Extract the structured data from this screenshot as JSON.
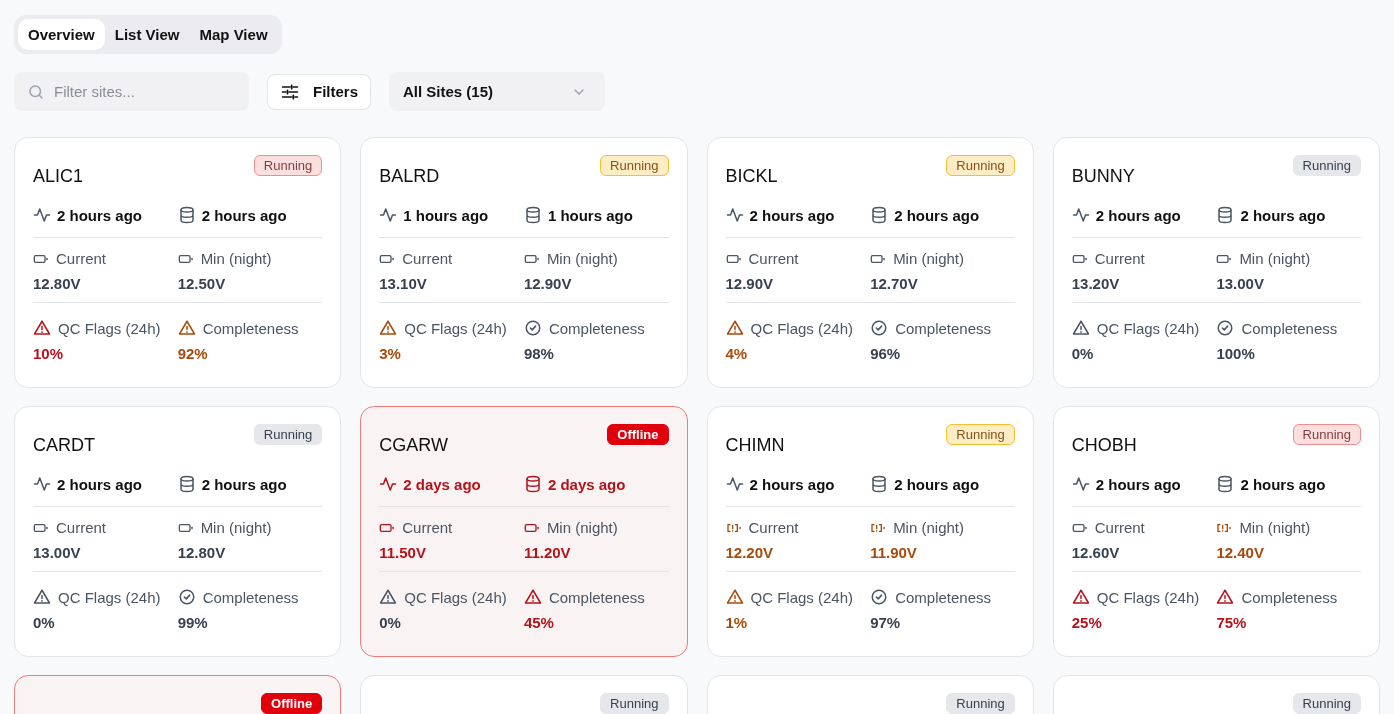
{
  "tabs": [
    {
      "label": "Overview",
      "selected": true
    },
    {
      "label": "List View",
      "selected": false
    },
    {
      "label": "Map View",
      "selected": false
    }
  ],
  "toolbar": {
    "search": {
      "placeholder": "Filter sites..."
    },
    "filters_button": "Filters",
    "site_select": "All Sites (15)"
  },
  "sites": [
    {
      "name": "ALIC1",
      "offline": false,
      "badge": {
        "label": "Running",
        "kind": "soft",
        "color": "#f28b8b"
      },
      "heartbeat": {
        "text": "2 hours ago",
        "critical": false
      },
      "data": {
        "text": "2 hours ago",
        "critical": false
      },
      "metrics": [
        {
          "kind": "battery",
          "label": "Current",
          "value": "12.80V",
          "warning": false,
          "critical": false
        },
        {
          "kind": "battery",
          "label": "Min (night)",
          "value": "12.50V",
          "warning": false,
          "critical": false
        },
        {
          "kind": "flags",
          "label": "QC Flags (24h)",
          "value": "10%",
          "warning": false,
          "critical": true
        },
        {
          "kind": "completeness",
          "label": "Completeness",
          "value": "92%",
          "warning": true,
          "critical": false
        }
      ]
    },
    {
      "name": "BALRD",
      "offline": false,
      "badge": {
        "label": "Running",
        "kind": "soft",
        "color": "#f5c030"
      },
      "heartbeat": {
        "text": "1 hours ago",
        "critical": false
      },
      "data": {
        "text": "1 hours ago",
        "critical": false
      },
      "metrics": [
        {
          "kind": "battery",
          "label": "Current",
          "value": "13.10V",
          "warning": false,
          "critical": false
        },
        {
          "kind": "battery",
          "label": "Min (night)",
          "value": "12.90V",
          "warning": false,
          "critical": false
        },
        {
          "kind": "flags",
          "label": "QC Flags (24h)",
          "value": "3%",
          "warning": true,
          "critical": false
        },
        {
          "kind": "completeness",
          "label": "Completeness",
          "value": "98%",
          "warning": false,
          "critical": false
        }
      ]
    },
    {
      "name": "BICKL",
      "offline": false,
      "badge": {
        "label": "Running",
        "kind": "soft",
        "color": "#f5c030"
      },
      "heartbeat": {
        "text": "2 hours ago",
        "critical": false
      },
      "data": {
        "text": "2 hours ago",
        "critical": false
      },
      "metrics": [
        {
          "kind": "battery",
          "label": "Current",
          "value": "12.90V",
          "warning": false,
          "critical": false
        },
        {
          "kind": "battery",
          "label": "Min (night)",
          "value": "12.70V",
          "warning": false,
          "critical": false
        },
        {
          "kind": "flags",
          "label": "QC Flags (24h)",
          "value": "4%",
          "warning": true,
          "critical": false
        },
        {
          "kind": "completeness",
          "label": "Completeness",
          "value": "96%",
          "warning": false,
          "critical": false
        }
      ]
    },
    {
      "name": "BUNNY",
      "offline": false,
      "badge": {
        "label": "Running",
        "kind": "plain",
        "color": "#e5e7eb"
      },
      "heartbeat": {
        "text": "2 hours ago",
        "critical": false
      },
      "data": {
        "text": "2 hours ago",
        "critical": false
      },
      "metrics": [
        {
          "kind": "battery",
          "label": "Current",
          "value": "13.20V",
          "warning": false,
          "critical": false
        },
        {
          "kind": "battery",
          "label": "Min (night)",
          "value": "13.00V",
          "warning": false,
          "critical": false
        },
        {
          "kind": "flags",
          "label": "QC Flags (24h)",
          "value": "0%",
          "warning": false,
          "critical": false
        },
        {
          "kind": "completeness",
          "label": "Completeness",
          "value": "100%",
          "warning": false,
          "critical": false
        }
      ]
    },
    {
      "name": "CARDT",
      "offline": false,
      "badge": {
        "label": "Running",
        "kind": "plain",
        "color": "#e5e7eb"
      },
      "heartbeat": {
        "text": "2 hours ago",
        "critical": false
      },
      "data": {
        "text": "2 hours ago",
        "critical": false
      },
      "metrics": [
        {
          "kind": "battery",
          "label": "Current",
          "value": "13.00V",
          "warning": false,
          "critical": false
        },
        {
          "kind": "battery",
          "label": "Min (night)",
          "value": "12.80V",
          "warning": false,
          "critical": false
        },
        {
          "kind": "flags",
          "label": "QC Flags (24h)",
          "value": "0%",
          "warning": false,
          "critical": false
        },
        {
          "kind": "completeness",
          "label": "Completeness",
          "value": "99%",
          "warning": false,
          "critical": false
        }
      ]
    },
    {
      "name": "CGARW",
      "offline": true,
      "badge": {
        "label": "Offline",
        "kind": "solid",
        "color": "#e0000b"
      },
      "heartbeat": {
        "text": "2 days ago",
        "critical": true
      },
      "data": {
        "text": "2 days ago",
        "critical": true
      },
      "metrics": [
        {
          "kind": "battery",
          "label": "Current",
          "value": "11.50V",
          "warning": false,
          "critical": true
        },
        {
          "kind": "battery",
          "label": "Min (night)",
          "value": "11.20V",
          "warning": false,
          "critical": true
        },
        {
          "kind": "flags",
          "label": "QC Flags (24h)",
          "value": "0%",
          "warning": false,
          "critical": false
        },
        {
          "kind": "completeness",
          "label": "Completeness",
          "value": "45%",
          "warning": false,
          "critical": true
        }
      ]
    },
    {
      "name": "CHIMN",
      "offline": false,
      "badge": {
        "label": "Running",
        "kind": "soft",
        "color": "#f5c030"
      },
      "heartbeat": {
        "text": "2 hours ago",
        "critical": false
      },
      "data": {
        "text": "2 hours ago",
        "critical": false
      },
      "metrics": [
        {
          "kind": "battery",
          "label": "Current",
          "value": "12.20V",
          "warning": true,
          "critical": false
        },
        {
          "kind": "battery",
          "label": "Min (night)",
          "value": "11.90V",
          "warning": true,
          "critical": false
        },
        {
          "kind": "flags",
          "label": "QC Flags (24h)",
          "value": "1%",
          "warning": true,
          "critical": false
        },
        {
          "kind": "completeness",
          "label": "Completeness",
          "value": "97%",
          "warning": false,
          "critical": false
        }
      ]
    },
    {
      "name": "CHOBH",
      "offline": false,
      "badge": {
        "label": "Running",
        "kind": "soft",
        "color": "#f28b8b"
      },
      "heartbeat": {
        "text": "2 hours ago",
        "critical": false
      },
      "data": {
        "text": "2 hours ago",
        "critical": false
      },
      "metrics": [
        {
          "kind": "battery",
          "label": "Current",
          "value": "12.60V",
          "warning": false,
          "critical": false
        },
        {
          "kind": "battery",
          "label": "Min (night)",
          "value": "12.40V",
          "warning": true,
          "critical": false
        },
        {
          "kind": "flags",
          "label": "QC Flags (24h)",
          "value": "25%",
          "warning": false,
          "critical": true
        },
        {
          "kind": "completeness",
          "label": "Completeness",
          "value": "75%",
          "warning": false,
          "critical": true
        }
      ]
    },
    {
      "offline": true,
      "badge": {
        "label": "Offline",
        "kind": "solid",
        "color": "#e0000b"
      }
    },
    {
      "offline": false,
      "badge": {
        "label": "Running",
        "kind": "plain",
        "color": "#e5e7eb"
      }
    },
    {
      "offline": false,
      "badge": {
        "label": "Running",
        "kind": "plain",
        "color": "#e5e7eb"
      }
    },
    {
      "offline": false,
      "badge": {
        "label": "Running",
        "kind": "plain",
        "color": "#e5e7eb"
      }
    }
  ]
}
